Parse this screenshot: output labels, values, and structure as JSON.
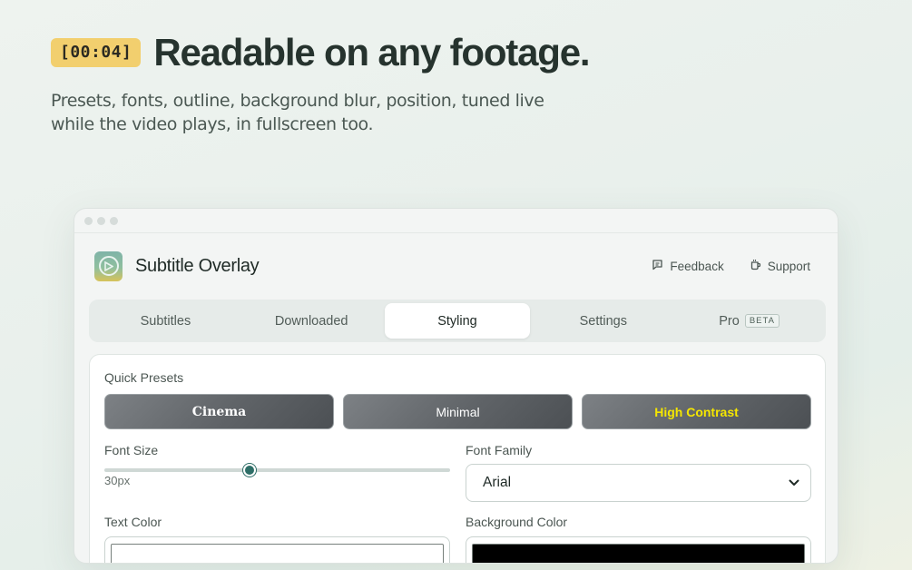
{
  "hero": {
    "timecode": "[00:04]",
    "title": "Readable on any footage.",
    "subtitle": "Presets, fonts, outline, background blur, position, tuned live while the video plays, in fullscreen too."
  },
  "app": {
    "name": "Subtitle Overlay",
    "logo_icon": "play-circle-logo",
    "actions": [
      {
        "label": "Feedback",
        "icon": "chat-bubble-icon"
      },
      {
        "label": "Support",
        "icon": "mug-icon"
      }
    ]
  },
  "tabs": [
    {
      "label": "Subtitles",
      "active": false
    },
    {
      "label": "Downloaded",
      "active": false
    },
    {
      "label": "Styling",
      "active": true
    },
    {
      "label": "Settings",
      "active": false
    },
    {
      "label": "Pro",
      "badge": "BETA",
      "active": false
    }
  ],
  "styling": {
    "quick_presets_label": "Quick Presets",
    "presets": [
      "Cinema",
      "Minimal",
      "High Contrast"
    ],
    "font_size": {
      "label": "Font Size",
      "value": "30px",
      "fraction": 0.42
    },
    "font_family": {
      "label": "Font Family",
      "value": "Arial"
    },
    "text_color": {
      "label": "Text Color",
      "value": "#ffffff"
    },
    "background_color": {
      "label": "Background Color",
      "value": "#000000"
    }
  },
  "colors": {
    "accent": "#2e6e67",
    "badge": "#f2cf6e",
    "high_contrast_text": "#f5e600"
  }
}
